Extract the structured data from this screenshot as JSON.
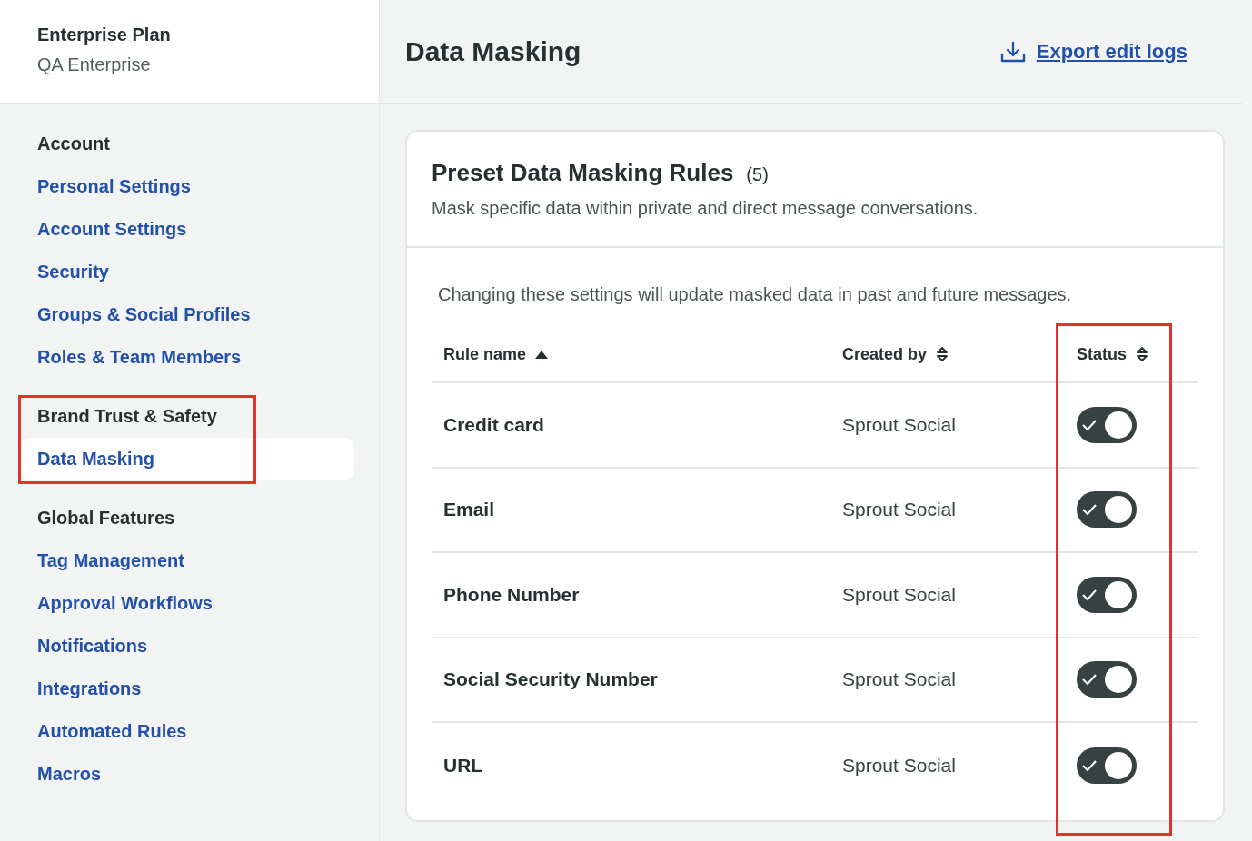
{
  "plan": {
    "title": "Enterprise Plan",
    "subtitle": "QA Enterprise"
  },
  "sidebar": {
    "groups": [
      {
        "heading": "Account",
        "highlight": false,
        "items": [
          {
            "label": "Personal Settings",
            "selected": false
          },
          {
            "label": "Account Settings",
            "selected": false
          },
          {
            "label": "Security",
            "selected": false
          },
          {
            "label": "Groups & Social Profiles",
            "selected": false
          },
          {
            "label": "Roles & Team Members",
            "selected": false
          }
        ]
      },
      {
        "heading": "Brand Trust & Safety",
        "highlight": true,
        "items": [
          {
            "label": "Data Masking",
            "selected": true
          }
        ]
      },
      {
        "heading": "Global Features",
        "highlight": false,
        "items": [
          {
            "label": "Tag Management",
            "selected": false
          },
          {
            "label": "Approval Workflows",
            "selected": false
          },
          {
            "label": "Notifications",
            "selected": false
          },
          {
            "label": "Integrations",
            "selected": false
          },
          {
            "label": "Automated Rules",
            "selected": false
          },
          {
            "label": "Macros",
            "selected": false
          }
        ]
      }
    ]
  },
  "page": {
    "title": "Data Masking",
    "export_link": "Export edit logs"
  },
  "card": {
    "title": "Preset Data Masking Rules",
    "count": "(5)",
    "description": "Mask specific data within private and direct message conversations.",
    "note": "Changing these settings will update masked data in past and future messages."
  },
  "table": {
    "columns": [
      {
        "label": "Rule name",
        "sorted": true,
        "highlight": false
      },
      {
        "label": "Created by",
        "sorted": false,
        "highlight": false
      },
      {
        "label": "Status",
        "sorted": false,
        "highlight": true
      }
    ],
    "rows": [
      {
        "name": "Credit card",
        "created_by": "Sprout Social",
        "on": true
      },
      {
        "name": "Email",
        "created_by": "Sprout Social",
        "on": true
      },
      {
        "name": "Phone Number",
        "created_by": "Sprout Social",
        "on": true
      },
      {
        "name": "Social Security Number",
        "created_by": "Sprout Social",
        "on": true
      },
      {
        "name": "URL",
        "created_by": "Sprout Social",
        "on": true
      }
    ]
  }
}
